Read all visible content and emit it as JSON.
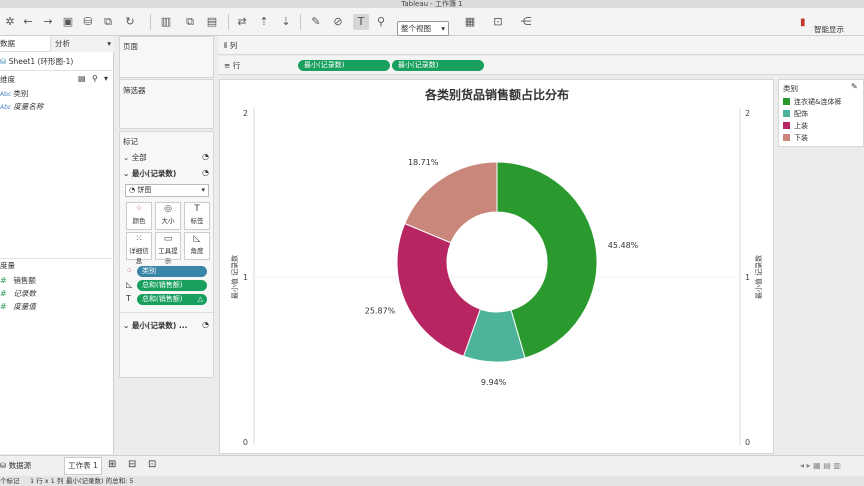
{
  "window": {
    "title": "Tableau - 工作簿 1"
  },
  "toolbar": {
    "fit_select": "整个视图",
    "smart_show": "智能显示"
  },
  "data_pane": {
    "tab_data": "数据",
    "tab_analysis": "分析",
    "datasource": "Sheet1 (环形图-1)",
    "dimensions_label": "维度",
    "dimensions": [
      {
        "type": "Abc",
        "name": "类别",
        "italic": false
      },
      {
        "type": "Abc",
        "name": "度量名称",
        "italic": true
      }
    ],
    "measures_label": "度量",
    "measures": [
      {
        "type": "#",
        "name": "销售额",
        "italic": false
      },
      {
        "type": "#",
        "name": "记录数",
        "italic": true
      },
      {
        "type": "#",
        "name": "度量值",
        "italic": true
      }
    ]
  },
  "cards": {
    "pages": "页面",
    "filters": "筛选器",
    "marks": "标记",
    "all": "全部",
    "min_records": "最小(记录数)",
    "mark_type": "饼图",
    "buttons": [
      {
        "icon": "color-icon",
        "glyph": "⁘",
        "label": "颜色"
      },
      {
        "icon": "size-icon",
        "glyph": "◎",
        "label": "大小"
      },
      {
        "icon": "label-icon",
        "glyph": "T",
        "label": "标签"
      },
      {
        "icon": "detail-icon",
        "glyph": "⁙",
        "label": "详细信息"
      },
      {
        "icon": "tooltip-icon",
        "glyph": "▭",
        "label": "工具提示"
      },
      {
        "icon": "angle-icon",
        "glyph": "◺",
        "label": "角度"
      }
    ],
    "pills": [
      {
        "icon": "color-icon",
        "glyph": "⁘",
        "label": "类别",
        "color": "blue"
      },
      {
        "icon": "angle-icon",
        "glyph": "◺",
        "label": "总和(销售额)",
        "color": "green"
      },
      {
        "icon": "label-icon",
        "glyph": "T",
        "label": "总和(销售额)",
        "color": "green"
      }
    ],
    "min_records_2": "最小(记录数) ..."
  },
  "shelves": {
    "columns_label": "列",
    "rows_label": "行",
    "rows_pills": [
      "最小(记录数)",
      "最小(记录数)"
    ]
  },
  "view": {
    "left_axis_title": "最小值 记录数",
    "right_axis_title": "最小值 记录数",
    "left_ticks": [
      "2",
      "1",
      "0"
    ],
    "right_ticks": [
      "2",
      "1",
      "0"
    ]
  },
  "legend": {
    "title": "类别"
  },
  "tabs": {
    "datasource_tab": "数据源",
    "sheet_tab": "工作表 1"
  },
  "status": {
    "marks": "个标记",
    "rows_cols": "1 行 x 1 列",
    "sum": "最小(记录数) 的总和: 5"
  },
  "chart_data": {
    "type": "pie",
    "title": "各类别货品销售额占比分布",
    "variant": "donut",
    "legend_title": "类别",
    "legend_position": "top-right",
    "slices": [
      {
        "label": "连衣裙&连体裤",
        "value": 45.48,
        "display": "45.48%",
        "color": "#2a9a2f"
      },
      {
        "label": "配饰",
        "value": 9.94,
        "display": "9.94%",
        "color": "#4db39a"
      },
      {
        "label": "上装",
        "value": 25.87,
        "display": "25.87%",
        "color": "#b82563"
      },
      {
        "label": "下装",
        "value": 18.71,
        "display": "18.71%",
        "color": "#c8877a"
      }
    ]
  }
}
